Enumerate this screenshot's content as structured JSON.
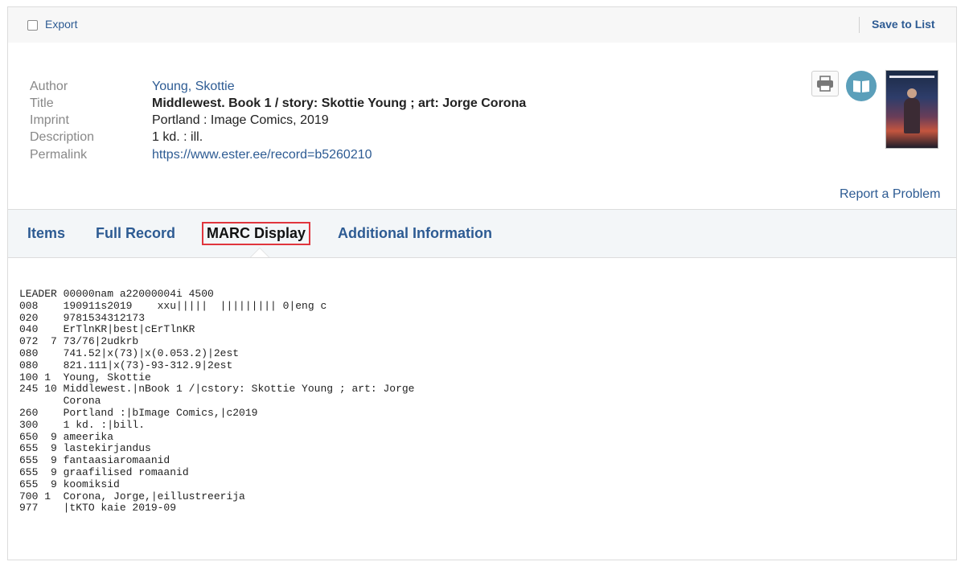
{
  "toolbar": {
    "export_label": "Export",
    "save_label": "Save to List"
  },
  "record": {
    "fields": [
      {
        "label": "Author",
        "value": "Young, Skottie"
      },
      {
        "label": "Title",
        "value": "Middlewest. Book 1 / story: Skottie Young ; art: Jorge Corona"
      },
      {
        "label": "Imprint",
        "value": "Portland : Image Comics, 2019"
      },
      {
        "label": "Description",
        "value": "1 kd. : ill."
      },
      {
        "label": "Permalink",
        "value": "https://www.ester.ee/record=b5260210"
      }
    ],
    "icons": [
      "printer-icon",
      "book-icon",
      "cover-image"
    ],
    "report_label": "Report a Problem"
  },
  "tabs": [
    {
      "label": "Items"
    },
    {
      "label": "Full Record"
    },
    {
      "label": "MARC Display",
      "active": true
    },
    {
      "label": "Additional Information"
    }
  ],
  "marc": {
    "lines": [
      "LEADER 00000nam a22000004i 4500",
      "008    190911s2019    xxu|||||  ||||||||| 0|eng c",
      "020    9781534312173",
      "040    ErTlnKR|best|cErTlnKR",
      "072  7 73/76|2udkrb",
      "080    741.52|x(73)|x(0.053.2)|2est",
      "080    821.111|x(73)-93-312.9|2est",
      "100 1  Young, Skottie",
      "245 10 Middlewest.|nBook 1 /|cstory: Skottie Young ; art: Jorge",
      "       Corona",
      "260    Portland :|bImage Comics,|c2019",
      "300    1 kd. :|bill.",
      "650  9 ameerika",
      "655  9 lastekirjandus",
      "655  9 fantaasiaromaanid",
      "655  9 graafilised romaanid",
      "655  9 koomiksid",
      "700 1  Corona, Jorge,|eillustreerija",
      "977    |tKTO kaie 2019-09"
    ]
  },
  "colors": {
    "link": "#2d5b93",
    "active_tab_border": "#e0353d",
    "book_button": "#5b9fba"
  }
}
